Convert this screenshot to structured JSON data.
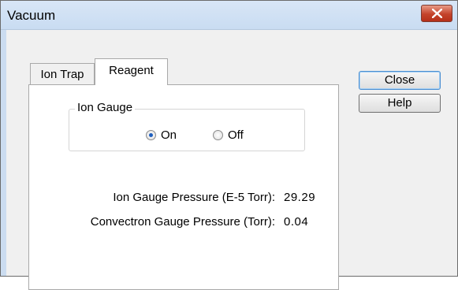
{
  "window": {
    "title": "Vacuum"
  },
  "tabs": [
    {
      "label": "Ion Trap",
      "selected": false
    },
    {
      "label": "Reagent",
      "selected": true
    }
  ],
  "ion_gauge": {
    "group_label": "Ion Gauge",
    "on_label": "On",
    "off_label": "Off",
    "selected": "On"
  },
  "readouts": [
    {
      "label": "Ion Gauge Pressure (E-5 Torr):",
      "value": "29.29"
    },
    {
      "label": "Convectron Gauge Pressure (Torr):",
      "value": "0.04"
    }
  ],
  "buttons": {
    "close_label": "Close",
    "help_label": "Help"
  },
  "colors": {
    "title_bar": "#c9dcf2",
    "close_button": "#c4432b",
    "radio_selected": "#1f5fbf"
  }
}
